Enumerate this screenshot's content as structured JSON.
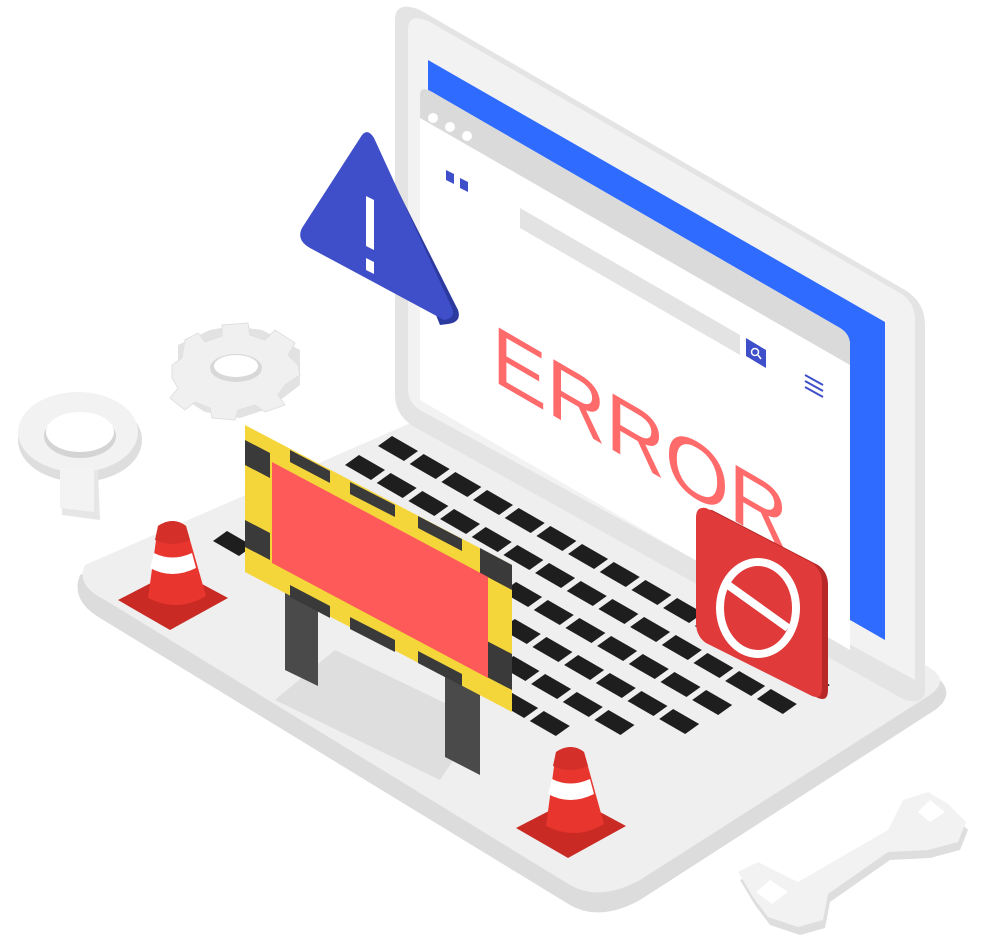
{
  "illustration": {
    "screen_text": "ERROR",
    "colors": {
      "screen_accent": "#2f6bff",
      "warning_triangle": "#3f4fc9",
      "error_text": "#ff6b6b",
      "barrier_board": "#ff5a5a",
      "barrier_stripe_yellow": "#f5d63a",
      "barrier_stripe_dark": "#3a3a3a",
      "stop_sign": "#e03a3a",
      "cone": "#e8352e",
      "keyboard_keys": "#1e1e1e",
      "laptop_body": "#ededed"
    },
    "icons": [
      "warning-icon",
      "gear-icon",
      "magnifier-icon",
      "stop-icon",
      "traffic-cone-icon",
      "wrench-icon",
      "search-icon",
      "menu-icon",
      "barrier-icon"
    ]
  }
}
